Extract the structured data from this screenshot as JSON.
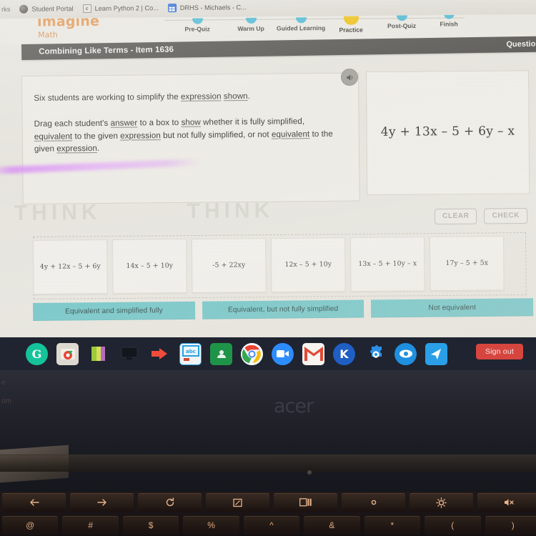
{
  "browser": {
    "clipped_bookmark": "rks",
    "tabs": [
      {
        "title": "Student Portal",
        "icon": "globe-icon"
      },
      {
        "title": "Learn Python 2 | Co...",
        "icon": "document-icon"
      },
      {
        "title": "DRHS - Michaels - C...",
        "icon": "spreadsheet-icon"
      }
    ]
  },
  "site": {
    "logo_primary": "imagine",
    "logo_secondary": "Math",
    "progress": [
      {
        "label": "Pre-Quiz",
        "active": false
      },
      {
        "label": "Warm Up",
        "active": false
      },
      {
        "label": "Guided Learning",
        "active": false
      },
      {
        "label": "Practice",
        "active": true
      },
      {
        "label": "Post-Quiz",
        "active": false
      },
      {
        "label": "Finish",
        "active": false
      }
    ],
    "accent_teal": "#52bdd6",
    "accent_active": "#f0c419",
    "accent_orange": "#e59a55"
  },
  "titlebar": {
    "lesson_title": "Combining Like Terms - Item 1636",
    "question_label": "Question",
    "bar_color": "#5a5955"
  },
  "question": {
    "line1_parts": [
      {
        "t": "Six students are working to simplify the ",
        "u": false
      },
      {
        "t": "expression",
        "u": true
      },
      {
        "t": " ",
        "u": false
      },
      {
        "t": "shown",
        "u": true
      },
      {
        "t": ".",
        "u": false
      }
    ],
    "line2_parts": [
      {
        "t": "Drag each student's ",
        "u": false
      },
      {
        "t": "answer",
        "u": true
      },
      {
        "t": " to a box to ",
        "u": false
      },
      {
        "t": "show",
        "u": true
      },
      {
        "t": " whether it is fully simplified, ",
        "u": false
      },
      {
        "t": "equivalent",
        "u": true
      },
      {
        "t": " to the given ",
        "u": false
      },
      {
        "t": "expression",
        "u": true
      },
      {
        "t": " but not fully simplified, or not ",
        "u": false
      },
      {
        "t": "equivalent",
        "u": true
      },
      {
        "t": " to the given ",
        "u": false
      },
      {
        "t": "expression",
        "u": true
      },
      {
        "t": ".",
        "u": false
      }
    ],
    "given_expression": "4y + 13x – 5 + 6y – x",
    "audio_icon": "speaker-icon"
  },
  "actions": {
    "clear_label": "CLEAR",
    "check_label": "CHECK"
  },
  "tiles": [
    {
      "text": "4y + 12x – 5 + 6y"
    },
    {
      "text": "14x – 5 + 10y"
    },
    {
      "text": "-5 + 22xy"
    },
    {
      "text": "12x – 5 + 10y"
    },
    {
      "text": "13x – 5 + 10y – x"
    },
    {
      "text": "17y – 5 + 5x"
    }
  ],
  "drop_zones": [
    {
      "label": "Equivalent and simplified fully"
    },
    {
      "label": "Equivalent, but not fully simplified"
    },
    {
      "label": "Not equivalent"
    }
  ],
  "watermark": {
    "text_a": "THINK",
    "text_b": "THINK"
  },
  "shelf": {
    "background": "#1f2430",
    "icons": [
      {
        "name": "grammarly-icon",
        "glyph": "G",
        "bg": "#15c39a",
        "shape": "circle"
      },
      {
        "name": "chrome-files-icon",
        "glyph": "",
        "bg": "#d9d6cf",
        "shape": "square"
      },
      {
        "name": "keep-notes-icon",
        "glyph": "",
        "bg": "#8cc63f",
        "shape": "square"
      },
      {
        "name": "display-monitor-icon",
        "glyph": "",
        "bg": "#111318",
        "shape": "square"
      },
      {
        "name": "red-arrow-icon",
        "glyph": "",
        "bg": "#e8483c",
        "shape": "square"
      },
      {
        "name": "blue-app-icon",
        "glyph": "",
        "bg": "#2a9fe0",
        "shape": "square"
      },
      {
        "name": "google-classroom-icon",
        "glyph": "",
        "bg": "#1f9448",
        "shape": "square"
      },
      {
        "name": "chrome-icon",
        "glyph": "",
        "bg": "#ffffff",
        "shape": "circle"
      },
      {
        "name": "zoom-icon",
        "glyph": "",
        "bg": "#2d8cff",
        "shape": "circle"
      },
      {
        "name": "gmail-icon",
        "glyph": "M",
        "bg": "#f5f2ef",
        "shape": "square"
      },
      {
        "name": "kami-icon",
        "glyph": "K",
        "bg": "#1f66c9",
        "shape": "circle"
      },
      {
        "name": "goguardian-icon",
        "glyph": "",
        "bg": "#2a8fe8",
        "shape": "square"
      },
      {
        "name": "eye-monitor-icon",
        "glyph": "",
        "bg": "#1f8fe0",
        "shape": "circle"
      },
      {
        "name": "nearpod-icon",
        "glyph": "",
        "bg": "#2a9fe8",
        "shape": "square"
      }
    ],
    "sign_out_label": "Sign out",
    "sign_out_color": "#d7453f"
  },
  "device": {
    "brand": "acer",
    "keys_function_row": [
      {
        "name": "back-key",
        "glyph": "←"
      },
      {
        "name": "forward-key",
        "glyph": "→"
      },
      {
        "name": "reload-key",
        "glyph": "⟳"
      },
      {
        "name": "fullscreen-key",
        "glyph": "◰"
      },
      {
        "name": "overview-key",
        "glyph": "▣"
      },
      {
        "name": "brightness-down-key",
        "glyph": "○"
      },
      {
        "name": "brightness-up-key",
        "glyph": "☀"
      },
      {
        "name": "mute-key",
        "glyph": "🔇"
      }
    ],
    "keys_number_row": [
      {
        "name": "at-key",
        "glyph": "@"
      },
      {
        "name": "hash-key",
        "glyph": "#"
      },
      {
        "name": "dollar-key",
        "glyph": "$"
      },
      {
        "name": "percent-key",
        "glyph": "%"
      },
      {
        "name": "caret-key",
        "glyph": "^"
      },
      {
        "name": "ampersand-key",
        "glyph": "&"
      },
      {
        "name": "asterisk-key",
        "glyph": "*"
      },
      {
        "name": "open-paren-key",
        "glyph": "("
      },
      {
        "name": "close-paren-key",
        "glyph": ")"
      }
    ]
  }
}
